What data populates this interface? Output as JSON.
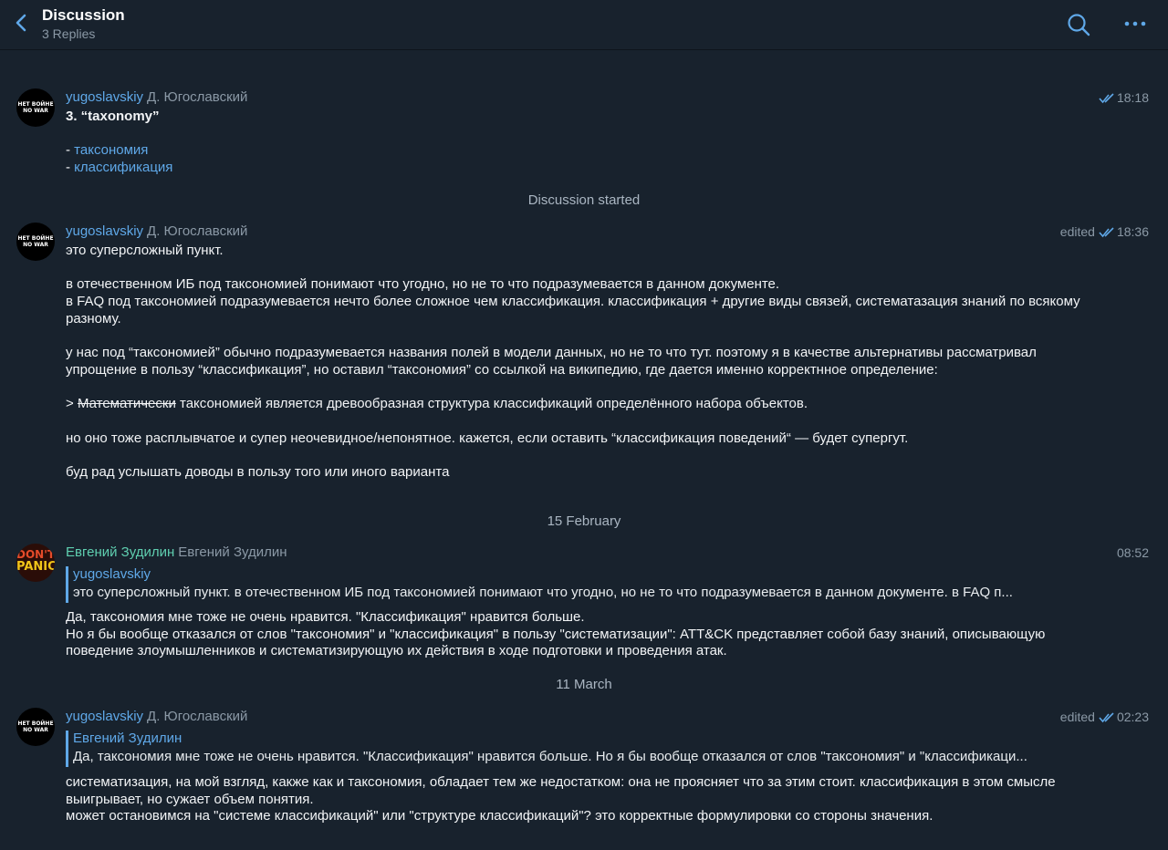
{
  "header": {
    "title": "Discussion",
    "subtitle": "3 Replies"
  },
  "colors": {
    "background": "#18222d",
    "accent": "#5fa8e8",
    "author_green": "#5fcfb0"
  },
  "messages": [
    {
      "author": "yugoslavskiy",
      "rank": "Д. Югославский",
      "time": "18:18",
      "edited": "",
      "avatar_text": [
        "НЕТ ВОЙНЕ",
        "NO WAR"
      ],
      "title": "3. “taxonomy”",
      "list": [
        {
          "dash": "- ",
          "text": "таксономия"
        },
        {
          "dash": "- ",
          "text": "классификация"
        }
      ]
    },
    {
      "author": "yugoslavskiy",
      "rank": "Д. Югославский",
      "time": "18:36",
      "edited": "edited",
      "avatar_text": [
        "НЕТ ВОЙНЕ",
        "NO WAR"
      ],
      "p1": "это суперсложный пункт.",
      "p2": "в отечественном ИБ под таксономией понимают что угодно, но не то что подразумевается в данном документе.",
      "p3": "в FAQ под таксономией подразумевается нечто более сложное чем классификация. классификация + другие виды связей, систематазация знаний по всякому разному.",
      "p4": "у нас под “таксономией” обычно подразумевается названия полей в модели данных, но не то что тут. поэтому я в качестве альтернативы рассматривал упрощение в пользу “классификация”, но оставил “таксономия” со ссылкой на википедию, где дается именно корректнное определение:",
      "quote_prefix": "> ",
      "quote_struck": "Математически",
      "quote_rest": " таксономией является древообразная структура классификаций определённого набора объектов.",
      "p5": "но оно тоже расплывчатое и супер неочевидное/непонятное. кажется, если оставить “классификация поведений“ — будет супергут.",
      "p6": "буд рад услышать доводы в пользу того или иного варианта"
    },
    {
      "author": "Евгений Зудилин",
      "rank": "Евгений Зудилин",
      "time": "08:52",
      "edited": "",
      "avatar_text": [
        "DON'T",
        "PANIC"
      ],
      "reply_to": {
        "name": "yugoslavskiy",
        "text": "это суперсложный пункт.  в отечественном ИБ под таксономией понимают что угодно, но не то что подразумевается в данном документе.  в FAQ п..."
      },
      "lines": [
        "Да, таксономия мне тоже не очень нравится. \"Классификация\" нравится больше.",
        "Но я бы вообще отказался от слов \"таксономия\" и \"классификация\" в пользу \"систематизации\": ATT&CK представляет собой базу знаний, описывающую поведение злоумышленников и систематизирующую их действия в ходе подготовки и проведения атак."
      ]
    },
    {
      "author": "yugoslavskiy",
      "rank": "Д. Югославский",
      "time": "02:23",
      "edited": "edited",
      "avatar_text": [
        "НЕТ ВОЙНЕ",
        "NO WAR"
      ],
      "reply_to": {
        "name": "Евгений Зудилин",
        "text": "Да, таксономия мне тоже не очень нравится. \"Классификация\" нравится больше. Но я бы вообще отказался от слов \"таксономия\" и \"классификаци..."
      },
      "lines": [
        "систематизация, на мой взгляд, какже как и таксономия, обладает тем же недостатком: она не проясняет что за этим стоит. классификация в этом смысле выигрывает, но сужает объем понятия.",
        "может остановимся на \"системе классификаций\" или \"структуре классификаций\"? это корректные формулировки со стороны значения."
      ]
    }
  ],
  "service": {
    "started": "Discussion started",
    "date1": "15 February",
    "date2": "11 March"
  }
}
